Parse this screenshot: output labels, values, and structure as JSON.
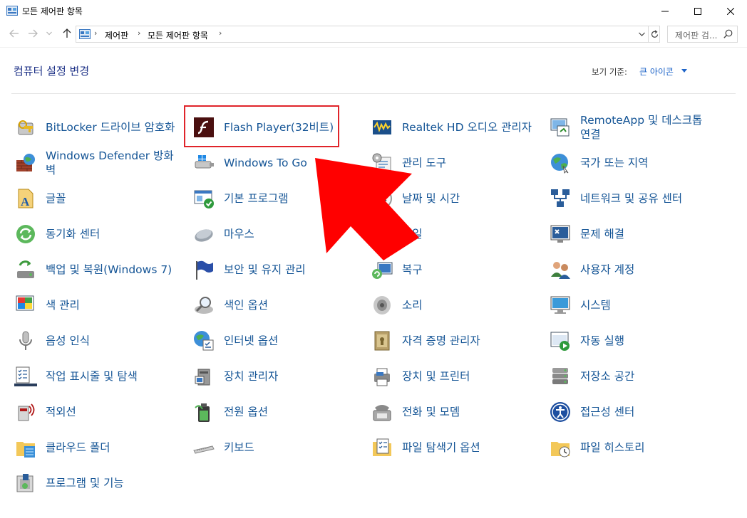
{
  "window": {
    "title": "모든 제어판 항목"
  },
  "address": {
    "crumbs": [
      "제어판",
      "모든 제어판 항목"
    ],
    "search_placeholder": "제어판 검..."
  },
  "header": {
    "title": "컴퓨터 설정 변경",
    "view_by_label": "보기 기준:",
    "view_by_value": "큰 아이콘"
  },
  "items": [
    {
      "label": "BitLocker 드라이브 암호화",
      "icon": "bitlocker-icon"
    },
    {
      "label": "Flash Player(32비트)",
      "icon": "flash-icon"
    },
    {
      "label": "Realtek HD 오디오 관리자",
      "icon": "realtek-icon"
    },
    {
      "label": "RemoteApp 및 데스크톱 연결",
      "icon": "remoteapp-icon"
    },
    {
      "label": "Windows Defender 방화벽",
      "icon": "firewall-icon"
    },
    {
      "label": "Windows To Go",
      "icon": "windows-to-go-icon"
    },
    {
      "label": "관리 도구",
      "icon": "admin-tools-icon"
    },
    {
      "label": "국가 또는 지역",
      "icon": "region-icon"
    },
    {
      "label": "글꼴",
      "icon": "fonts-icon"
    },
    {
      "label": "기본 프로그램",
      "icon": "default-programs-icon"
    },
    {
      "label": "날짜 및 시간",
      "icon": "clock-icon"
    },
    {
      "label": "네트워크 및 공유 센터",
      "icon": "network-icon"
    },
    {
      "label": "동기화 센터",
      "icon": "sync-icon"
    },
    {
      "label": "마우스",
      "icon": "mouse-icon"
    },
    {
      "label": "메일",
      "icon": "mail-icon"
    },
    {
      "label": "문제 해결",
      "icon": "troubleshoot-icon"
    },
    {
      "label": "백업 및 복원(Windows 7)",
      "icon": "backup-icon"
    },
    {
      "label": "보안 및 유지 관리",
      "icon": "security-flag-icon"
    },
    {
      "label": "복구",
      "icon": "recovery-icon"
    },
    {
      "label": "사용자 계정",
      "icon": "user-accounts-icon"
    },
    {
      "label": "색 관리",
      "icon": "color-management-icon"
    },
    {
      "label": "색인 옵션",
      "icon": "indexing-icon"
    },
    {
      "label": "소리",
      "icon": "sound-icon"
    },
    {
      "label": "시스템",
      "icon": "system-icon"
    },
    {
      "label": "음성 인식",
      "icon": "microphone-icon"
    },
    {
      "label": "인터넷 옵션",
      "icon": "internet-options-icon"
    },
    {
      "label": "자격 증명 관리자",
      "icon": "credential-icon"
    },
    {
      "label": "자동 실행",
      "icon": "autoplay-icon"
    },
    {
      "label": "작업 표시줄 및 탐색",
      "icon": "taskbar-icon"
    },
    {
      "label": "장치 관리자",
      "icon": "device-manager-icon"
    },
    {
      "label": "장치 및 프린터",
      "icon": "printer-icon"
    },
    {
      "label": "저장소 공간",
      "icon": "storage-icon"
    },
    {
      "label": "적외선",
      "icon": "infrared-icon"
    },
    {
      "label": "전원 옵션",
      "icon": "power-icon"
    },
    {
      "label": "전화 및 모뎀",
      "icon": "phone-modem-icon"
    },
    {
      "label": "접근성 센터",
      "icon": "ease-of-access-icon"
    },
    {
      "label": "클라우드 폴더",
      "icon": "work-folders-icon"
    },
    {
      "label": "키보드",
      "icon": "keyboard-icon"
    },
    {
      "label": "파일 탐색기 옵션",
      "icon": "folder-options-icon"
    },
    {
      "label": "파일 히스토리",
      "icon": "file-history-icon"
    },
    {
      "label": "프로그램 및 기능",
      "icon": "programs-features-icon"
    }
  ],
  "colors": {
    "link": "#155596",
    "title": "#1e3287",
    "highlight_border": "#e0242a",
    "arrow": "#ff0000"
  }
}
